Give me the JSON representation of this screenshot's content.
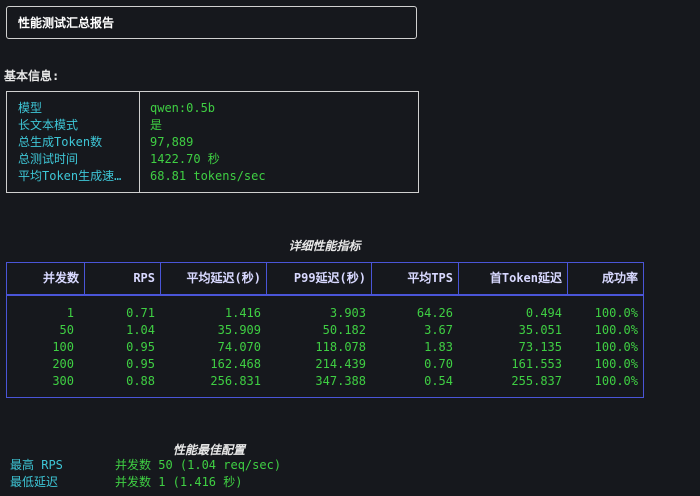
{
  "report_title": "性能测试汇总报告",
  "basic_info": {
    "label": "基本信息:",
    "rows": [
      {
        "key": "模型",
        "value": "qwen:0.5b"
      },
      {
        "key": "长文本模式",
        "value": "是"
      },
      {
        "key": "总生成Token数",
        "value": "97,889"
      },
      {
        "key": "总测试时间",
        "value": "1422.70 秒"
      },
      {
        "key": "平均Token生成速…",
        "value": "68.81 tokens/sec"
      }
    ]
  },
  "metrics_table": {
    "title": "详细性能指标",
    "columns": [
      "并发数",
      "RPS",
      "平均延迟(秒)",
      "P99延迟(秒)",
      "平均TPS",
      "首Token延迟",
      "成功率"
    ],
    "rows": [
      [
        "1",
        "0.71",
        "1.416",
        "3.903",
        "64.26",
        "0.494",
        "100.0%"
      ],
      [
        "50",
        "1.04",
        "35.909",
        "50.182",
        "3.67",
        "35.051",
        "100.0%"
      ],
      [
        "100",
        "0.95",
        "74.070",
        "118.078",
        "1.83",
        "73.135",
        "100.0%"
      ],
      [
        "200",
        "0.95",
        "162.468",
        "214.439",
        "0.70",
        "161.553",
        "100.0%"
      ],
      [
        "300",
        "0.88",
        "256.831",
        "347.388",
        "0.54",
        "255.837",
        "100.0%"
      ]
    ]
  },
  "best_config": {
    "title": "性能最佳配置",
    "rows": [
      {
        "key": "最高 RPS",
        "value": "并发数 50 (1.04 req/sec)"
      },
      {
        "key": "最低延迟",
        "value": "并发数 1 (1.416 秒)"
      }
    ]
  },
  "colors": {
    "background": "#16181d",
    "key_cyan": "#3ec6d6",
    "value_green": "#3fcf43",
    "table_border": "#4a55d8"
  }
}
